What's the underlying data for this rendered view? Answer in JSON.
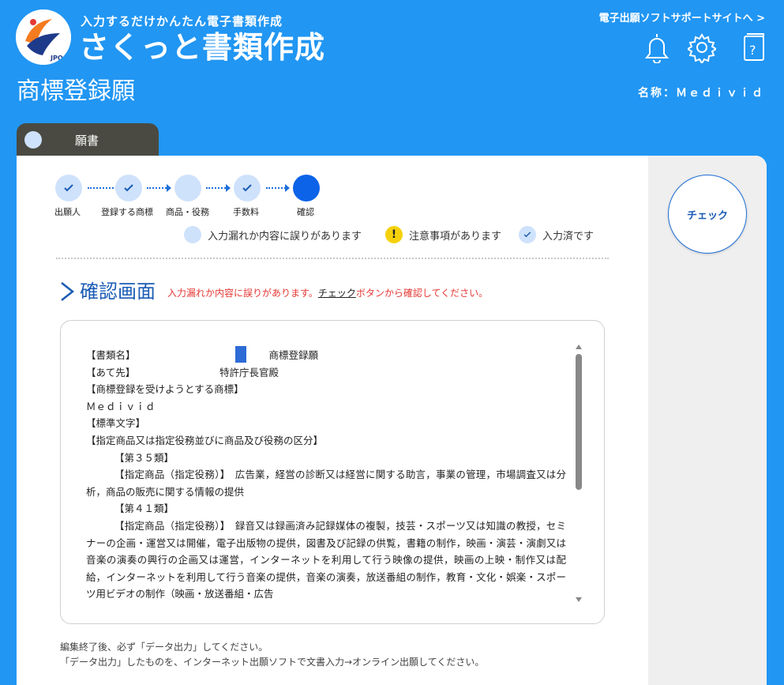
{
  "header": {
    "tagline": "入力するだけかんたん電子書類作成",
    "app_title": "さくっと書類作成",
    "logo_text": "JPO",
    "support_link": "電子出願ソフトサポートサイトへ >",
    "page_title": "商標登録願",
    "name_label": "名称：Ｍｅｄｉｖｉｄ"
  },
  "tab": {
    "label": "願書"
  },
  "steps": [
    {
      "label": "出願人",
      "state": "done"
    },
    {
      "label": "登録する商標",
      "state": "done"
    },
    {
      "label": "商品・役務",
      "state": "incomplete"
    },
    {
      "label": "手数料",
      "state": "done"
    },
    {
      "label": "確認",
      "state": "current"
    }
  ],
  "legend": {
    "incomplete": "入力漏れか内容に誤りがあります",
    "warning_symbol": "!",
    "warning": "注意事項があります",
    "done": "入力済です"
  },
  "section": {
    "title": "確認画面",
    "msg_before": "入力漏れか内容に誤りがあります。",
    "msg_link": "チェック",
    "msg_after": "ボタンから確認してください。"
  },
  "check_button": "チェック",
  "document": {
    "doc_type_key": "【書類名】",
    "doc_type_val": "商標登録願",
    "to_key": "【あて先】",
    "to_val": "特許庁長官殿",
    "mark_head": "【商標登録を受けようとする商標】",
    "mark_val": "Ｍｅｄｉｖｉｄ",
    "std_char": "【標準文字】",
    "goods_head": "【指定商品又は指定役務並びに商品及び役務の区分】",
    "class1": "【第３５類】",
    "goods1": "【指定商品（指定役務）】　広告業，経営の診断又は経営に関する助言，事業の管理，市場調査又は分析，商品の販売に関する情報の提供",
    "class2": "【第４１類】",
    "goods2": "【指定商品（指定役務）】　録音又は録画済み記録媒体の複製，技芸・スポーツ又は知識の教授，セミナーの企画・運営又は開催，電子出版物の提供，図書及び記録の供覧，書籍の制作，映画・演芸・演劇又は音楽の演奏の興行の企画又は運営，インターネットを利用して行う映像の提供，映画の上映・制作又は配給，インターネットを利用して行う音楽の提供，音楽の演奏，放送番組の制作，教育・文化・娯楽・スポーツ用ビデオの制作（映画・放送番組・広告"
  },
  "footnote": {
    "line1": "編集終了後、必ず「データ出力」してください。",
    "line2": "「データ出力」したものを、インターネット出願ソフトで文書入力→オンライン出願してください。"
  },
  "colors": {
    "brand_blue": "#2196f3",
    "step_blue": "#0c63e8",
    "step_light": "#cfe2fb",
    "error_red": "#e53935",
    "warn_yellow": "#f5d10c"
  }
}
